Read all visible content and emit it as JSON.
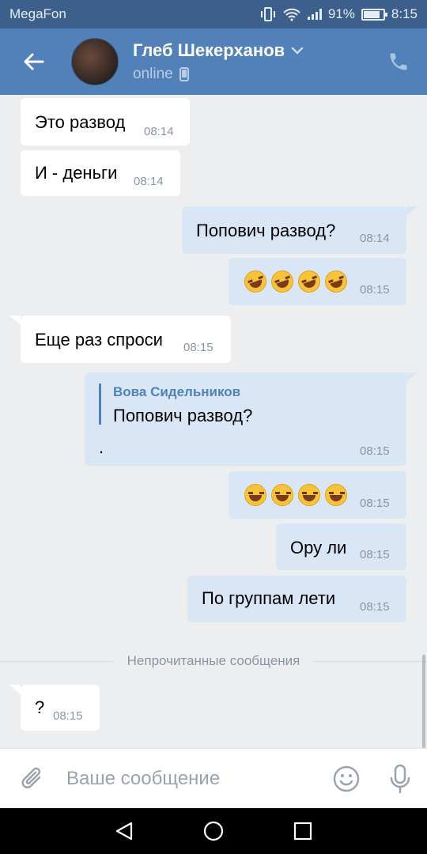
{
  "status_bar": {
    "carrier": "MegaFon",
    "battery": "91%",
    "time": "8:15"
  },
  "header": {
    "name": "Глеб Шекерханов",
    "status": "online"
  },
  "messages": [
    {
      "dir": "in",
      "text": "Это развод",
      "time": "08:14"
    },
    {
      "dir": "in",
      "text": "И - деньги",
      "time": "08:14"
    },
    {
      "dir": "out",
      "text": "Попович развод?",
      "time": "08:14"
    },
    {
      "dir": "out",
      "emoji": "rofl-emoji x4",
      "time": "08:15"
    },
    {
      "dir": "in",
      "text": "Еще раз спроси",
      "time": "08:15"
    },
    {
      "dir": "out",
      "reply_author": "Вова Сидельников",
      "reply_text": "Попович развод?",
      "text": ".",
      "time": "08:15"
    },
    {
      "dir": "out",
      "emoji": "tears-of-joy-emoji x4",
      "time": "08:15"
    },
    {
      "dir": "out",
      "text": "Ору ли",
      "time": "08:15"
    },
    {
      "dir": "out",
      "text": "По группам лети",
      "time": "08:15"
    },
    {
      "dir": "in",
      "text": "?",
      "time": "08:15"
    }
  ],
  "unread_divider": "Непрочитанные сообщения",
  "input": {
    "placeholder": "Ваше сообщение"
  },
  "colors": {
    "header": "#5181b8",
    "status_bar": "#3d5f8c",
    "bubble_out": "#d9e6f5",
    "bubble_in": "#ffffff",
    "background": "#edeef0"
  }
}
